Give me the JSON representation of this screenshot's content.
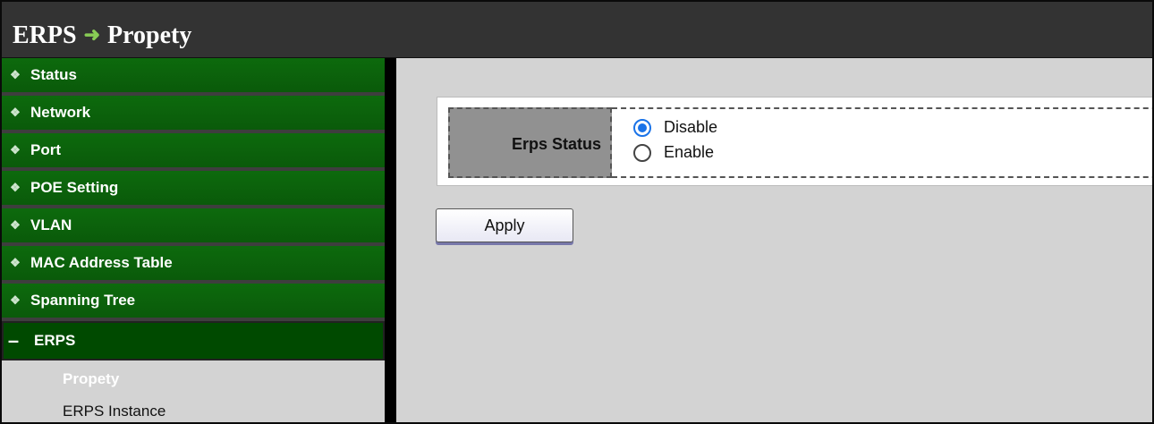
{
  "header": {
    "section": "ERPS",
    "arrow_icon": "right-arrow-icon",
    "page": "Propety"
  },
  "sidebar": {
    "items": [
      {
        "label": "Status",
        "icon": "expand-icon"
      },
      {
        "label": "Network",
        "icon": "expand-icon"
      },
      {
        "label": "Port",
        "icon": "expand-icon"
      },
      {
        "label": "POE Setting",
        "icon": "expand-icon"
      },
      {
        "label": "VLAN",
        "icon": "expand-icon"
      },
      {
        "label": "MAC Address Table",
        "icon": "expand-icon"
      },
      {
        "label": "Spanning Tree",
        "icon": "expand-icon"
      }
    ],
    "open_item": {
      "label": "ERPS",
      "icon": "collapse-icon"
    },
    "sub_items": [
      {
        "label": "Propety",
        "active": true
      },
      {
        "label": "ERPS Instance",
        "active": false
      }
    ]
  },
  "form": {
    "erps_status": {
      "label": "Erps Status",
      "options": [
        "Disable",
        "Enable"
      ],
      "selected": "Disable"
    },
    "apply_label": "Apply"
  },
  "colors": {
    "menu_green": "#0a5a0a",
    "title_bar": "#333333",
    "radio_accent": "#1a73e8"
  }
}
